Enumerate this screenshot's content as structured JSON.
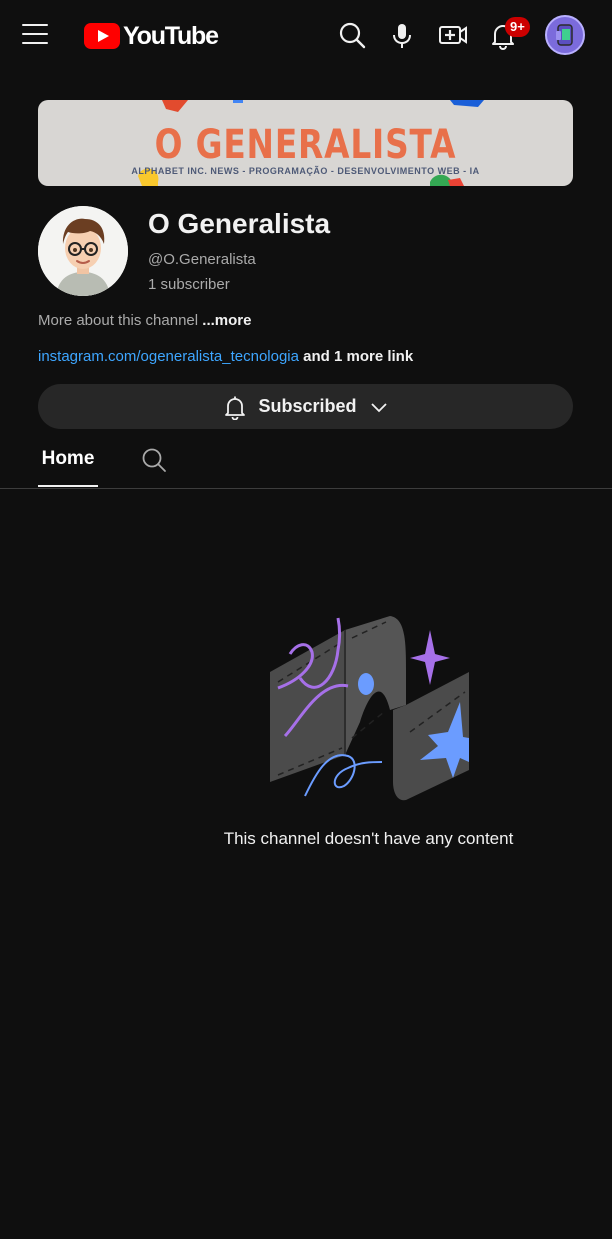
{
  "app": {
    "brand": "YouTube"
  },
  "header": {
    "notification_count": "9+",
    "icons": [
      "menu-icon",
      "search-icon",
      "mic-icon",
      "create-icon",
      "bell-icon",
      "account-avatar"
    ]
  },
  "banner": {
    "title": "O GENERALISTA",
    "subtitle": "ALPHABET INC. NEWS - PROGRAMAÇÃO - DESENVOLVIMENTO WEB - IA"
  },
  "channel": {
    "name": "O Generalista",
    "handle": "@O.Generalista",
    "subscribers": "1 subscriber",
    "about_text": "More about this channel ",
    "about_more": "...more",
    "link": "instagram.com/ogeneralista_tecnologia",
    "more_links": " and 1 more link"
  },
  "subscribe": {
    "label": "Subscribed"
  },
  "tabs": [
    {
      "label": "Home",
      "active": true
    }
  ],
  "empty_state": {
    "message": "This channel doesn't have any content"
  },
  "colors": {
    "background": "#0f0f0f",
    "accent_red": "#ff0000",
    "link": "#3ea6ff",
    "button": "#272727"
  }
}
